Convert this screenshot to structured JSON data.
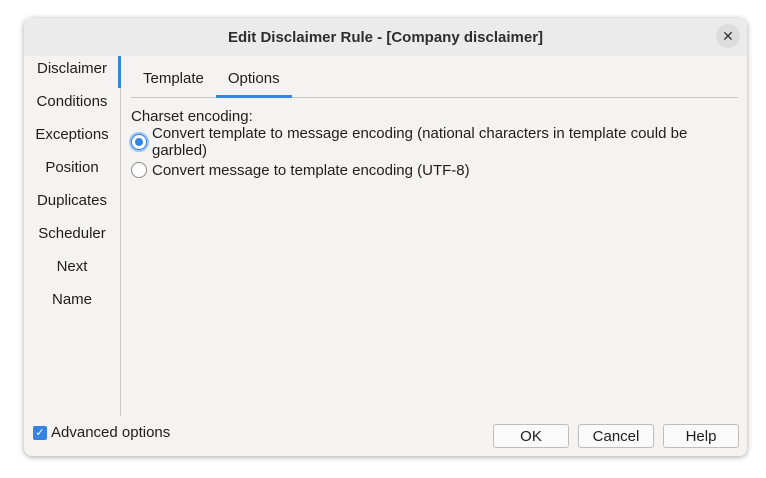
{
  "window": {
    "title": "Edit Disclaimer Rule - [Company disclaimer]",
    "close_glyph": "✕"
  },
  "sidebar": {
    "items": [
      {
        "label": "Disclaimer"
      },
      {
        "label": "Conditions"
      },
      {
        "label": "Exceptions"
      },
      {
        "label": "Position"
      },
      {
        "label": "Duplicates"
      },
      {
        "label": "Scheduler"
      },
      {
        "label": "Next"
      },
      {
        "label": "Name"
      }
    ],
    "active": "Disclaimer"
  },
  "tabs": [
    {
      "label": "Template"
    },
    {
      "label": "Options"
    }
  ],
  "active_tab": "Options",
  "options": {
    "charset_label": "Charset encoding:",
    "radio1": "Convert template to message encoding (national characters in template could be garbled)",
    "radio2": "Convert message to template encoding (UTF-8)",
    "selected": "radio1"
  },
  "footer": {
    "advanced_label": "Advanced options",
    "advanced_checked": true,
    "ok": "OK",
    "cancel": "Cancel",
    "help": "Help"
  },
  "colors": {
    "accent": "#3584e4"
  }
}
